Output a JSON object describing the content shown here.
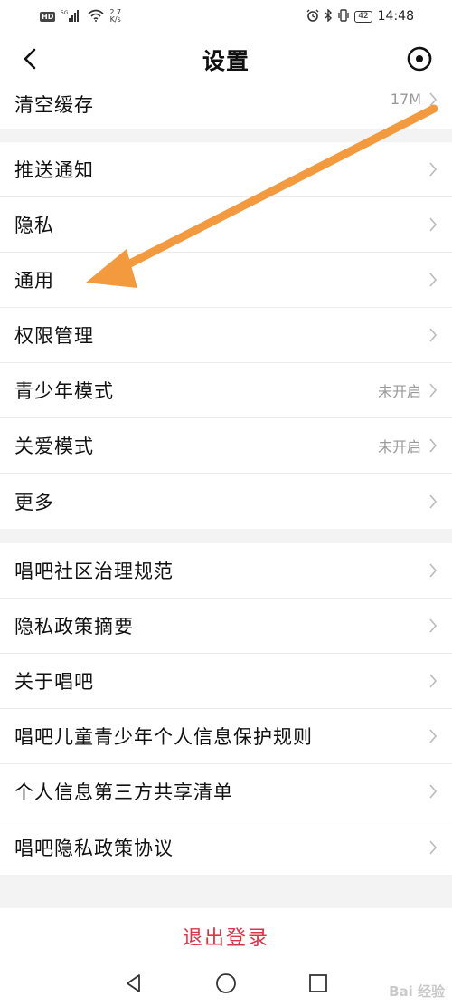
{
  "status_bar": {
    "hd": "HD",
    "signal_gen": "5G",
    "net_speed_value": "2.7",
    "net_speed_unit": "K/s",
    "battery": "42",
    "time": "14:48"
  },
  "header": {
    "title": "设置",
    "back_icon": "chevron-left-icon",
    "scan_icon": "scan-icon"
  },
  "cache": {
    "label": "清空缓存",
    "value": "17M"
  },
  "settings": [
    {
      "label": "推送通知",
      "value": ""
    },
    {
      "label": "隐私",
      "value": ""
    },
    {
      "label": "通用",
      "value": ""
    },
    {
      "label": "权限管理",
      "value": ""
    },
    {
      "label": "青少年模式",
      "value": "未开启"
    },
    {
      "label": "关爱模式",
      "value": "未开启"
    },
    {
      "label": "更多",
      "value": ""
    }
  ],
  "legal": [
    {
      "label": "唱吧社区治理规范"
    },
    {
      "label": "隐私政策摘要"
    },
    {
      "label": "关于唱吧"
    },
    {
      "label": "唱吧儿童青少年个人信息保护规则"
    },
    {
      "label": "个人信息第三方共享清单"
    },
    {
      "label": "唱吧隐私政策协议"
    }
  ],
  "logout_label": "退出登录",
  "annotation": {
    "arrow_color": "#f39a3e"
  },
  "watermark": "Bai 经验",
  "colors": {
    "logout_text": "#d9364a",
    "secondary_text": "#999999",
    "background": "#f3f3f3"
  }
}
